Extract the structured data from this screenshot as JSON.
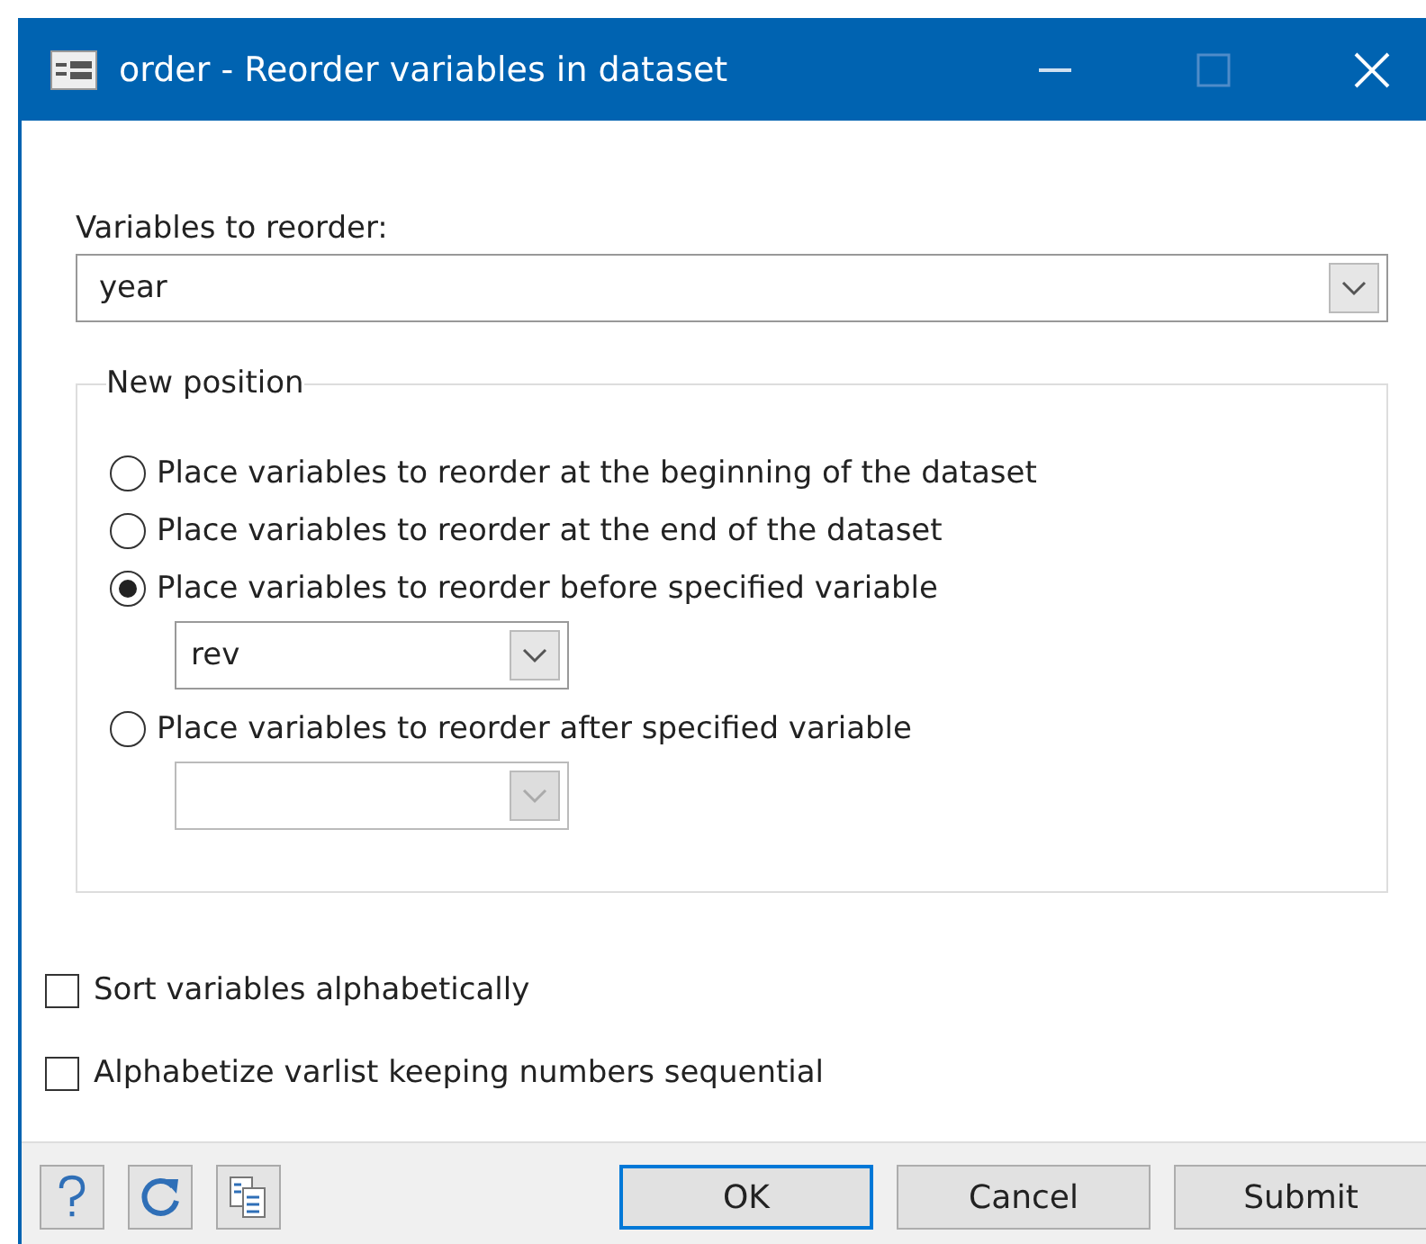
{
  "window": {
    "title": "order - Reorder variables in dataset"
  },
  "variables": {
    "label": "Variables to reorder:",
    "value": "year"
  },
  "new_position": {
    "title": "New position",
    "options": [
      {
        "label": "Place variables to reorder at the beginning of the dataset",
        "selected": false
      },
      {
        "label": "Place variables to reorder at the end of the dataset",
        "selected": false
      },
      {
        "label": "Place variables to reorder before specified variable",
        "selected": true,
        "dropdown": {
          "value": "rev",
          "disabled": false
        }
      },
      {
        "label": "Place variables to reorder after specified variable",
        "selected": false,
        "dropdown": {
          "disabled": true
        }
      }
    ]
  },
  "checkboxes": [
    {
      "label": "Sort variables alphabetically",
      "checked": false
    },
    {
      "label": "Alphabetize varlist keeping numbers sequential",
      "checked": false
    }
  ],
  "buttons": [
    {
      "label": "OK",
      "default": true
    },
    {
      "label": "Cancel",
      "default": false
    },
    {
      "label": "Submit",
      "default": false
    }
  ]
}
